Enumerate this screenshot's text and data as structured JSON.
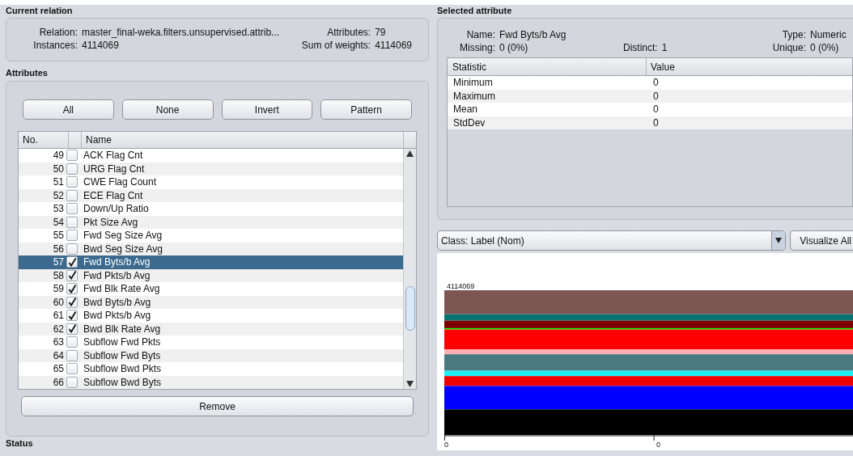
{
  "current_relation": {
    "title": "Current relation",
    "relation_label": "Relation:",
    "relation": "master_final-weka.filters.unsupervised.attrib...",
    "instances_label": "Instances:",
    "instances": "4114069",
    "attributes_label": "Attributes:",
    "attributes": "79",
    "sum_label": "Sum of weights:",
    "sum": "4114069"
  },
  "attributes": {
    "title": "Attributes",
    "buttons": [
      "All",
      "None",
      "Invert",
      "Pattern"
    ],
    "columns": [
      "No.",
      "Name"
    ],
    "rows": [
      {
        "no": "49",
        "name": "ACK Flag Cnt",
        "checked": false,
        "selected": false
      },
      {
        "no": "50",
        "name": "URG Flag Cnt",
        "checked": false,
        "selected": false
      },
      {
        "no": "51",
        "name": "CWE Flag Count",
        "checked": false,
        "selected": false
      },
      {
        "no": "52",
        "name": "ECE Flag Cnt",
        "checked": false,
        "selected": false
      },
      {
        "no": "53",
        "name": "Down/Up Ratio",
        "checked": false,
        "selected": false
      },
      {
        "no": "54",
        "name": "Pkt Size Avg",
        "checked": false,
        "selected": false
      },
      {
        "no": "55",
        "name": "Fwd Seg Size Avg",
        "checked": false,
        "selected": false
      },
      {
        "no": "56",
        "name": "Bwd Seg Size Avg",
        "checked": false,
        "selected": false
      },
      {
        "no": "57",
        "name": "Fwd Byts/b Avg",
        "checked": true,
        "selected": true
      },
      {
        "no": "58",
        "name": "Fwd Pkts/b Avg",
        "checked": true,
        "selected": false
      },
      {
        "no": "59",
        "name": "Fwd Blk Rate Avg",
        "checked": true,
        "selected": false
      },
      {
        "no": "60",
        "name": "Bwd Byts/b Avg",
        "checked": true,
        "selected": false
      },
      {
        "no": "61",
        "name": "Bwd Pkts/b Avg",
        "checked": true,
        "selected": false
      },
      {
        "no": "62",
        "name": "Bwd Blk Rate Avg",
        "checked": true,
        "selected": false
      },
      {
        "no": "63",
        "name": "Subflow Fwd Pkts",
        "checked": false,
        "selected": false
      },
      {
        "no": "64",
        "name": "Subflow Fwd Byts",
        "checked": false,
        "selected": false
      },
      {
        "no": "65",
        "name": "Subflow Bwd Pkts",
        "checked": false,
        "selected": false
      },
      {
        "no": "66",
        "name": "Subflow Bwd Byts",
        "checked": false,
        "selected": false
      }
    ],
    "remove_button": "Remove"
  },
  "selected_attribute": {
    "title": "Selected attribute",
    "name_label": "Name:",
    "name": "Fwd Byts/b Avg",
    "type_label": "Type:",
    "type": "Numeric",
    "missing_label": "Missing:",
    "missing": "0 (0%)",
    "distinct_label": "Distinct:",
    "distinct": "1",
    "unique_label": "Unique:",
    "unique": "0 (0%)",
    "columns": [
      "Statistic",
      "Value"
    ],
    "stats": [
      {
        "statistic": "Minimum",
        "value": "0"
      },
      {
        "statistic": "Maximum",
        "value": "0"
      },
      {
        "statistic": "Mean",
        "value": "0"
      },
      {
        "statistic": "StdDev",
        "value": "0"
      }
    ]
  },
  "class_select": {
    "value": "Class: Label (Nom)"
  },
  "visualize_button": "Visualize All",
  "histogram": {
    "count_label": "4114069",
    "axis_labels": [
      "0",
      "0"
    ]
  },
  "status": {
    "title": "Status"
  }
}
